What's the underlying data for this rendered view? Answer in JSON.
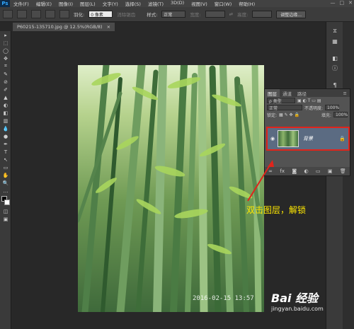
{
  "app": {
    "logo": "Ps"
  },
  "menubar": {
    "items": [
      "文件(F)",
      "编辑(E)",
      "图像(I)",
      "图层(L)",
      "文字(Y)",
      "选择(S)",
      "滤镜(T)",
      "3D(D)",
      "视图(V)",
      "窗口(W)",
      "帮助(H)"
    ],
    "win_minimize": "—",
    "win_restore": "□",
    "win_close": "✕"
  },
  "options": {
    "feather_label": "羽化:",
    "feather_value": "0 像素",
    "antialias_label": "消除锯齿",
    "style_label": "样式:",
    "style_value": "正常",
    "width_label": "宽度:",
    "height_label": "高度:",
    "refine_button": "调整边缘..."
  },
  "document": {
    "tab_title": "P60215-135710.jpg @ 12.5%(RGB/8)",
    "tab_close": "×",
    "photo_timestamp": "2016-02-15  13:57"
  },
  "tools": [
    "▸",
    "⬚",
    "◯",
    "✥",
    "⌗",
    "✎",
    "⊘",
    "✐",
    "▲",
    "◐",
    "⌕",
    "T",
    "↖",
    "▭",
    "✋",
    "🔍"
  ],
  "panel": {
    "tabs": [
      "图层",
      "通道",
      "路径"
    ],
    "active_tab": "图层",
    "kind_select": "ρ 类型",
    "blend_mode": "正常",
    "opacity_label": "不透明度:",
    "opacity_value": "100%",
    "lock_label": "锁定:",
    "fill_label": "填充:",
    "fill_value": "100%",
    "layer": {
      "name": "背景",
      "visible_icon": "eye-icon",
      "locked_icon": "lock-icon"
    },
    "footer_icons": [
      "∞",
      "fx",
      "◙",
      "◐",
      "▭",
      "▣",
      "🗑"
    ]
  },
  "annotation": {
    "text": "双击图层，解锁",
    "color": "#ffe800"
  },
  "watermark": {
    "logo": "Bai 经验",
    "url": "jingyan.baidu.com"
  },
  "colors": {
    "selection_border": "#e1241b",
    "layer_selected_bg": "#5b6b82"
  }
}
